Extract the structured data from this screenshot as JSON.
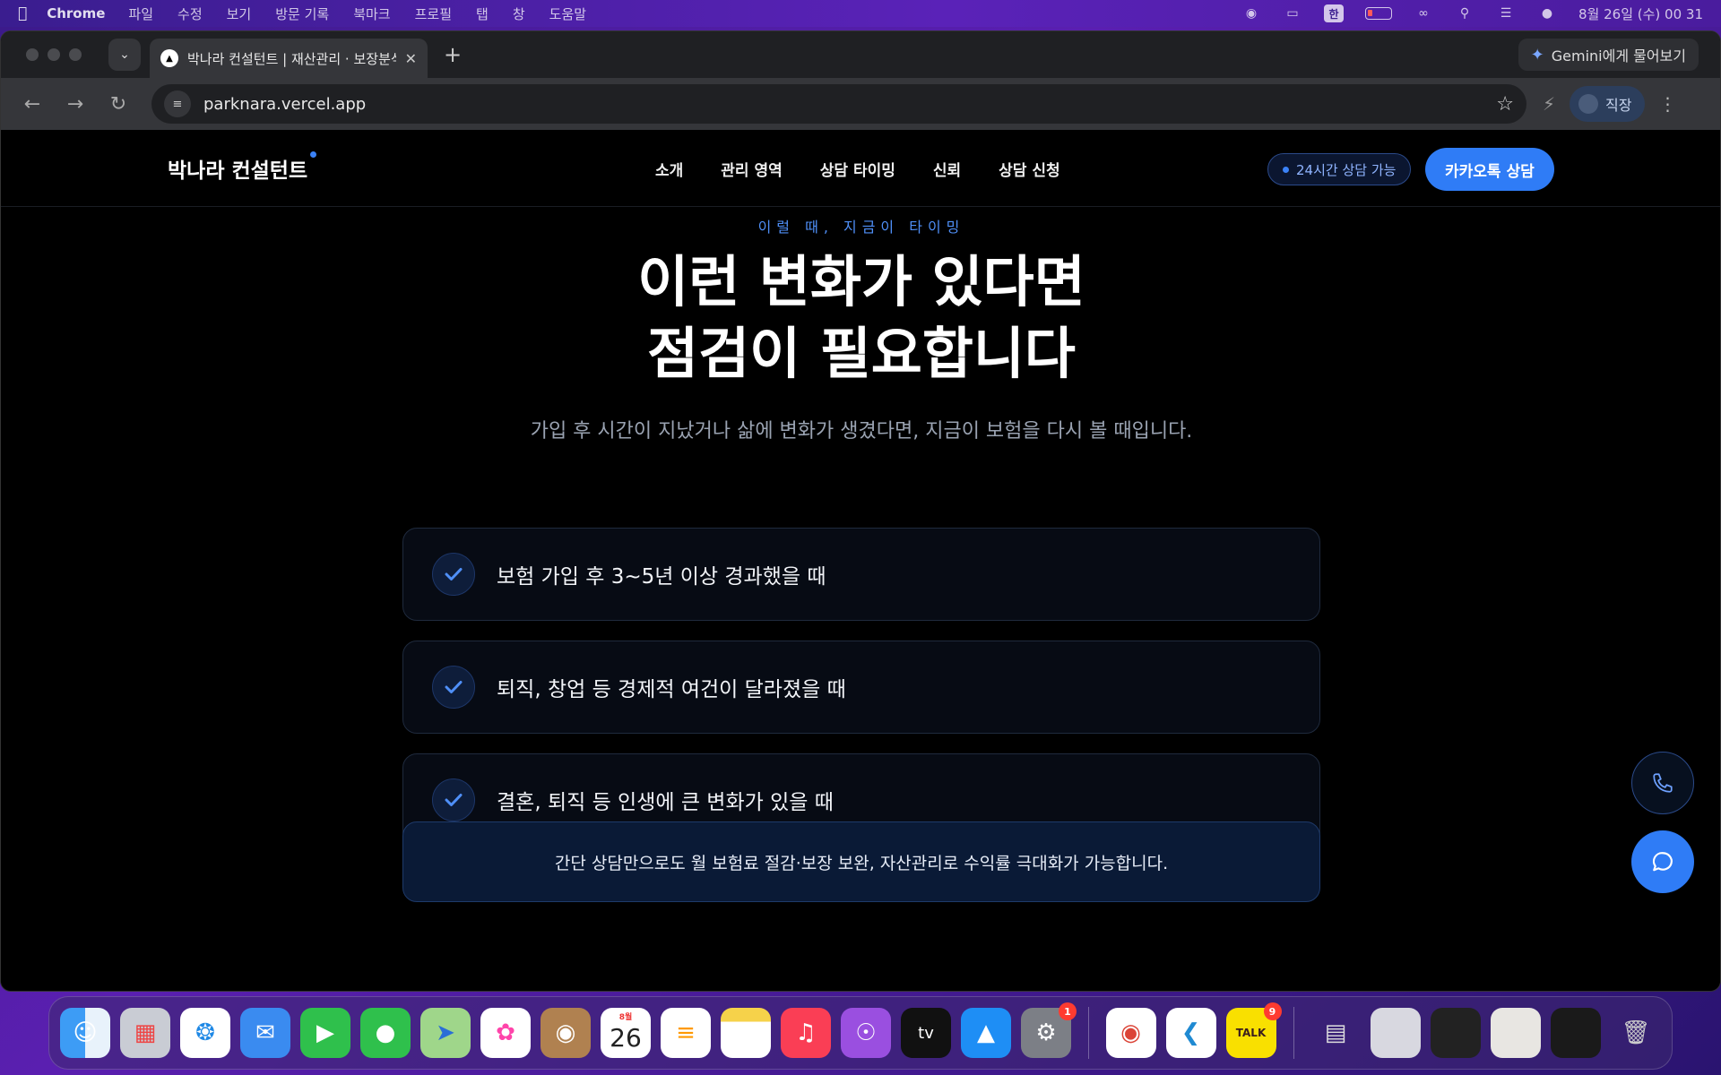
{
  "menubar": {
    "app": "Chrome",
    "items": [
      "파일",
      "수정",
      "보기",
      "방문 기록",
      "북마크",
      "프로필",
      "탭",
      "창",
      "도움말"
    ],
    "ime_key": "한",
    "clock": "8월 26일 (수) 00 31"
  },
  "browser": {
    "tab_title": "박나라 컨설턴트 | 재산관리 · 보장분석",
    "gemini_label": "Gemini에게 물어보기",
    "url": "parknara.vercel.app",
    "profile_label": "직장"
  },
  "site": {
    "logo": "박나라 컨설턴트",
    "nav": [
      "소개",
      "관리 영역",
      "상담 타이밍",
      "신뢰",
      "상담 신청"
    ],
    "badge": "24시간 상담 가능",
    "cta": "카카오톡 상담"
  },
  "section": {
    "kicker": "이럴 때, 지금이 타이밍",
    "headline_line1": "이런 변화가 있다면",
    "headline_line2": "점검이 필요합니다",
    "subtitle": "가입 후 시간이 지났거나 삶에 변화가 생겼다면, 지금이 보험을 다시 볼 때입니다.",
    "items": [
      "보험 가입 후 3~5년 이상 경과했을 때",
      "퇴직, 창업 등 경제적 여건이 달라졌을 때",
      "결혼, 퇴직 등 인생에 큰 변화가 있을 때"
    ],
    "notice": "간단 상담만으로도 월 보험료 절감·보장 보완, 자산관리로 수익률 극대화가 가능합니다."
  },
  "dock": {
    "calendar_month": "8월",
    "calendar_day": "26",
    "settings_badge": "1",
    "kakaotalk_badge": "9",
    "kakaotalk_label": "TALK",
    "appletv_label": "tv"
  }
}
